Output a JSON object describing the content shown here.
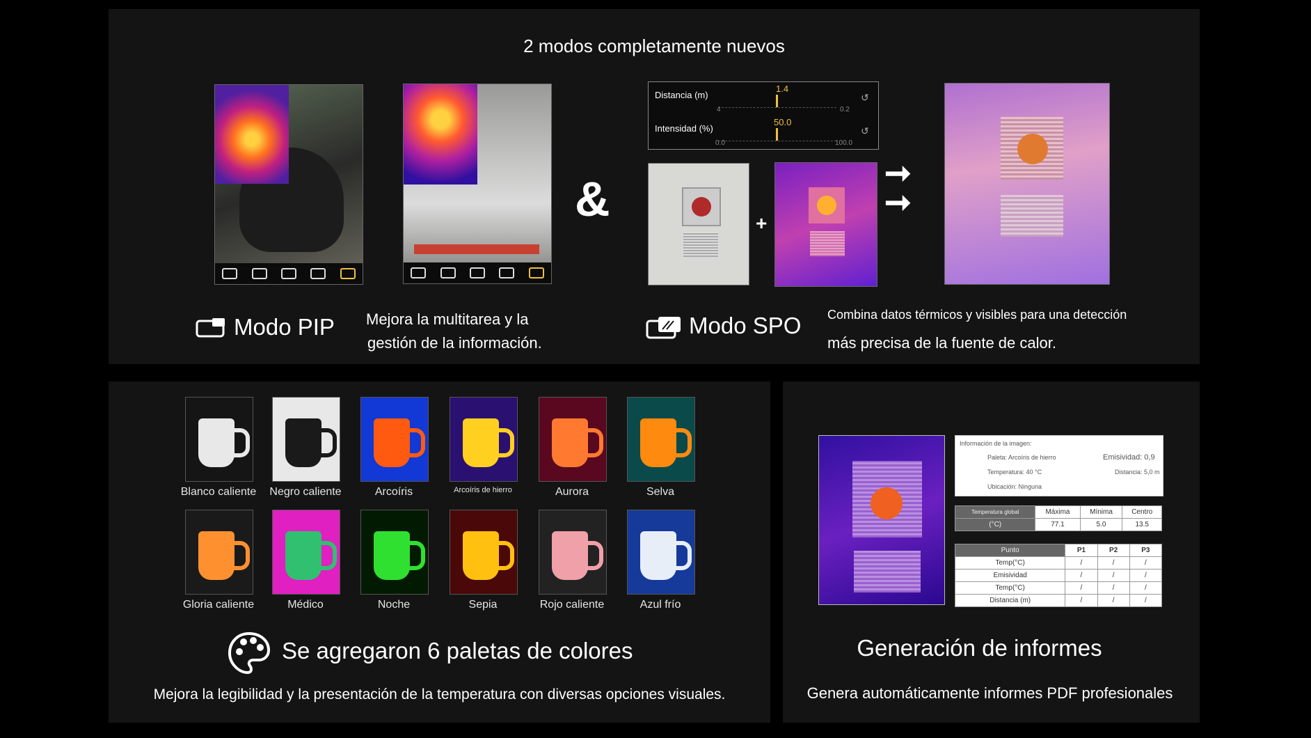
{
  "top": {
    "heading": "2 modos completamente nuevos",
    "ampersand": "&",
    "plus": "+",
    "pip": {
      "title": "Modo PIP",
      "desc_line1": "Mejora la multitarea y la",
      "desc_line2": "gestión de la información.",
      "icon": "pip-window-icon"
    },
    "spo": {
      "title": "Modo SPO",
      "desc_line1": "Combina datos térmicos y visibles para una detección",
      "desc_line2": "más precisa de la fuente de calor.",
      "icon": "spo-window-icon"
    },
    "sliders": [
      {
        "label": "Distancia (m)",
        "value": "1.4",
        "min": "4",
        "max": "0.2"
      },
      {
        "label": "Intensidad (%)",
        "value": "50.0",
        "min": "0.0",
        "max": "100.0"
      }
    ],
    "toolbar_icons": [
      "shape-icon",
      "rgb-icon",
      "mix-icon",
      "spot-icon",
      "pip-icon"
    ]
  },
  "palettes": {
    "title": "Se agregaron 6 paletas de colores",
    "desc": "Mejora la legibilidad y la presentación de la temperatura con diversas opciones visuales.",
    "icon": "palette-icon",
    "items": [
      {
        "label": "Blanco caliente",
        "bg": "#151515",
        "mug": "#e8e8e8"
      },
      {
        "label": "Negro caliente",
        "bg": "#e8e8e8",
        "mug": "#1a1a1a"
      },
      {
        "label": "Arcoíris",
        "bg": "#1238d6",
        "mug": "#ff5a10"
      },
      {
        "label": "Arcoíris de hierro",
        "bg": "#2a1070",
        "mug": "#ffd020"
      },
      {
        "label": "Aurora",
        "bg": "#5a0820",
        "mug": "#ff7a30"
      },
      {
        "label": "Selva",
        "bg": "#0a4a4a",
        "mug": "#ff8a10"
      },
      {
        "label": "Gloria caliente",
        "bg": "#1a1a1a",
        "mug": "#ff9030"
      },
      {
        "label": "Médico",
        "bg": "#e020c0",
        "mug": "#30c070"
      },
      {
        "label": "Noche",
        "bg": "#021a02",
        "mug": "#30e030"
      },
      {
        "label": "Sepia",
        "bg": "#4a0808",
        "mug": "#ffc010"
      },
      {
        "label": "Rojo caliente",
        "bg": "#222",
        "mug": "#f0a0a8"
      },
      {
        "label": "Azul frío",
        "bg": "#163a9a",
        "mug": "#e8eef8"
      }
    ]
  },
  "reports": {
    "title": "Generación de informes",
    "desc": "Genera automáticamente informes PDF profesionales",
    "info": {
      "heading": "Información de la imagen:",
      "paleta": "Paleta: Arcoíris de hierro",
      "emisividad": "Emisividad: 0,9",
      "temperatura": "Temperatura: 40 °C",
      "distancia": "Distancia: 5,0 m",
      "ubicacion": "Ubicación: Ninguna"
    },
    "global_table": {
      "headers": [
        "Temperatura global",
        "Máxima",
        "Mínima",
        "Centro"
      ],
      "row": [
        "(°C)",
        "77.1",
        "5.0",
        "13.5"
      ]
    },
    "point_table": {
      "headers": [
        "Punto",
        "P1",
        "P2",
        "P3"
      ],
      "rows": [
        [
          "Temp(°C)",
          "/",
          "/",
          "/"
        ],
        [
          "Emisividad",
          "/",
          "/",
          "/"
        ],
        [
          "Temp(°C)",
          "/",
          "/",
          "/"
        ],
        [
          "Distancia (m)",
          "/",
          "/",
          "/"
        ]
      ]
    }
  }
}
